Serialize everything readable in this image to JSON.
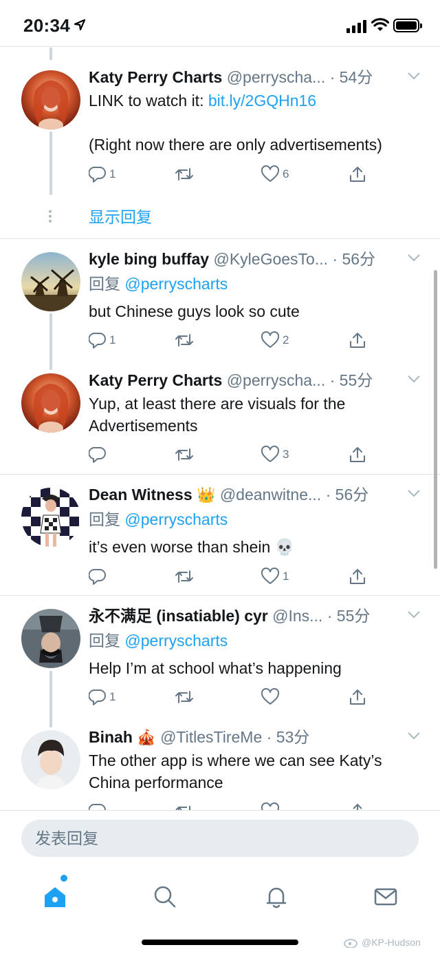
{
  "status_bar": {
    "time": "20:34"
  },
  "tweets": [
    {
      "name": "Katy Perry Charts",
      "handle": "@perryscha...",
      "dot": "·",
      "time": "54分",
      "text_prefix": "LINK to watch it: ",
      "link": "bit.ly/2GQHn16",
      "text2": "(Right now there are only advertisements)",
      "reply_count": "1",
      "retweet_count": "",
      "like_count": "6"
    },
    {
      "name": "kyle bing buffay",
      "handle": "@KyleGoesTo...",
      "dot": "·",
      "time": "56分",
      "reply_label": "回复",
      "reply_to": "@perryscharts",
      "text": "but Chinese guys look so cute",
      "reply_count": "1",
      "retweet_count": "",
      "like_count": "2"
    },
    {
      "name": "Katy Perry Charts",
      "handle": "@perryscha...",
      "dot": "·",
      "time": "55分",
      "text": "Yup, at least there are visuals for the Advertisements",
      "reply_count": "",
      "retweet_count": "",
      "like_count": "3"
    },
    {
      "name": "Dean Witness",
      "emoji": "👑",
      "handle": "@deanwitne...",
      "dot": "·",
      "time": "56分",
      "reply_label": "回复",
      "reply_to": "@perryscharts",
      "text": "it’s even worse than shein",
      "text_emoji": "💀",
      "reply_count": "",
      "retweet_count": "",
      "like_count": "1"
    },
    {
      "name": "永不满足 (insatiable) cyr",
      "handle": "@Ins...",
      "dot": "·",
      "time": "55分",
      "reply_label": "回复",
      "reply_to": "@perryscharts",
      "text": "Help I’m at school what’s happening",
      "reply_count": "1",
      "retweet_count": "",
      "like_count": ""
    },
    {
      "name": "Binah",
      "emoji": "🎪",
      "handle": "@TitlesTireMe",
      "dot": "·",
      "time": "53分",
      "text": "The other app is where we can see Katy’s China performance"
    }
  ],
  "show_replies": "显示回复",
  "composer": {
    "placeholder": "发表回复"
  },
  "tabs": [
    "home-icon",
    "search-icon",
    "notifications-icon",
    "messages-icon"
  ],
  "watermark": "@KP-Hudson",
  "colors": {
    "accent": "#1da1f2",
    "muted": "#657786",
    "divider": "#dfe3e8",
    "input_bg": "#e6ecf0"
  }
}
